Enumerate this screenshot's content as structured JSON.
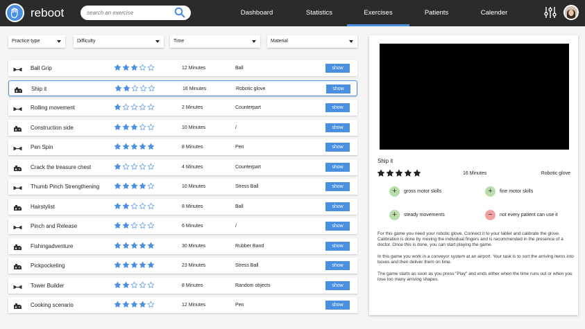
{
  "app": {
    "name": "reboot",
    "brand_color": "#4a8fe0"
  },
  "search": {
    "placeholder": "search an exercise"
  },
  "nav": [
    {
      "label": "Dashboard",
      "active": false
    },
    {
      "label": "Statistics",
      "active": false
    },
    {
      "label": "Exercises",
      "active": true
    },
    {
      "label": "Patients",
      "active": false
    },
    {
      "label": "Calender",
      "active": false
    }
  ],
  "filters": [
    {
      "label": "Practice type"
    },
    {
      "label": "Difficulty"
    },
    {
      "label": "Time"
    },
    {
      "label": "Material"
    }
  ],
  "exercises": [
    {
      "name": "Ball Grip",
      "icon": "dumbbell-icon",
      "rating": 3,
      "time": "12 Minutes",
      "material": "Ball",
      "action": "show",
      "selected": false
    },
    {
      "name": "Ship it",
      "icon": "gamepad-icon",
      "rating": 2,
      "time": "16 Minutes",
      "material": "Robotic glove",
      "action": "show",
      "selected": true
    },
    {
      "name": "Rolling movement",
      "icon": "dumbbell-icon",
      "rating": 1,
      "time": "2 Minutes",
      "material": "Counterpart",
      "action": "show",
      "selected": false
    },
    {
      "name": "Construction side",
      "icon": "gamepad-icon",
      "rating": 3,
      "time": "10 Minutes",
      "material": "/",
      "action": "show",
      "selected": false
    },
    {
      "name": "Pen Spin",
      "icon": "dumbbell-icon",
      "rating": 5,
      "time": "8 Minutes",
      "material": "Pen",
      "action": "show",
      "selected": false
    },
    {
      "name": "Crack the treasure chest",
      "icon": "gamepad-icon",
      "rating": 1,
      "time": "4 Minutes",
      "material": "Counterpart",
      "action": "show",
      "selected": false
    },
    {
      "name": "Thumb Pinch Strengthening",
      "icon": "dumbbell-icon",
      "rating": 4,
      "time": "10 Minutes",
      "material": "Stress Ball",
      "action": "show",
      "selected": false
    },
    {
      "name": "Hairstylist",
      "icon": "gamepad-icon",
      "rating": 2,
      "time": "8 Minutes",
      "material": "Ball",
      "action": "show",
      "selected": false
    },
    {
      "name": "Pinch and Release",
      "icon": "dumbbell-icon",
      "rating": 2,
      "time": "6 Minutes",
      "material": "/",
      "action": "show",
      "selected": false
    },
    {
      "name": "Fishingadventure",
      "icon": "gamepad-icon",
      "rating": 5,
      "time": "30 Minutes",
      "material": "Rubber Band",
      "action": "show",
      "selected": false
    },
    {
      "name": "Pickpocketing",
      "icon": "gamepad-icon",
      "rating": 5,
      "time": "23 Minutes",
      "material": "Stress Ball",
      "action": "show",
      "selected": false
    },
    {
      "name": "Tower Builder",
      "icon": "dumbbell-icon",
      "rating": 2,
      "time": "8 Minutes",
      "material": "Random objects",
      "action": "show",
      "selected": false
    },
    {
      "name": "Cooking scenario",
      "icon": "gamepad-icon",
      "rating": 4,
      "time": "12 Minutes",
      "material": "Pen",
      "action": "show",
      "selected": false
    }
  ],
  "detail": {
    "title": "Ship it",
    "rating": 5,
    "time": "16 Minutes",
    "material": "Robotic glove",
    "skills": [
      {
        "label": "gross motor skills",
        "type": "plus"
      },
      {
        "label": "fine motor skills",
        "type": "plus"
      },
      {
        "label": "steady movements",
        "type": "plus"
      },
      {
        "label": "not every patient can use it",
        "type": "minus"
      }
    ],
    "paragraphs": [
      "For this game you need your robotic glove. Connect it to your tablet and calibrate the glove. Calibration is done by moving the individual fingers and is recommended in the presence of a doctor. Once this is done, you can start playing the game.",
      "In this game you work in a conveyor system at an airport. Your task is to sort the arriving items into boxes and then deliver them on time.",
      "The game starts as soon as you press \"Play\" and ends either when the time runs out or when you lose too many arriving shapes."
    ]
  }
}
